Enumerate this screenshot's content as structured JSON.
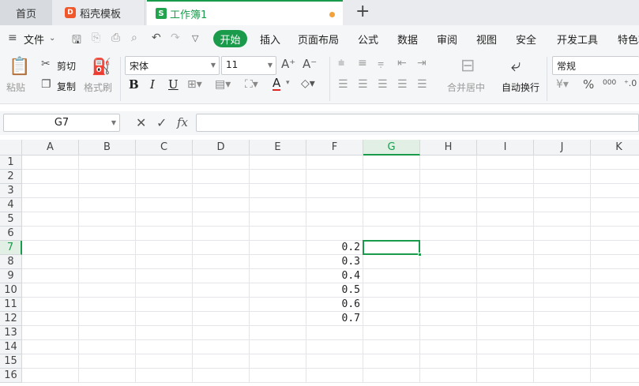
{
  "tabs": {
    "home": "首页",
    "template": "稻壳模板",
    "workbook": "工作簿1",
    "workbook_icon": "S",
    "template_icon": "D"
  },
  "menu": {
    "file": "文件",
    "start": "开始",
    "items": [
      "插入",
      "页面布局",
      "公式",
      "数据",
      "审阅",
      "视图",
      "安全",
      "开发工具",
      "特色功"
    ]
  },
  "ribbon": {
    "paste": "粘贴",
    "cut": "剪切",
    "copy": "复制",
    "format_painter": "格式刷",
    "font_name": "宋体",
    "font_size": "11",
    "merge_center": "合并居中",
    "wrap_text": "自动换行",
    "number_format": "常规",
    "percent_glyph": "%",
    "thousands_glyph": "000"
  },
  "formula_bar": {
    "name_box": "G7",
    "fx_label": "fx",
    "formula_value": ""
  },
  "sheet": {
    "columns": [
      "A",
      "B",
      "C",
      "D",
      "E",
      "F",
      "G",
      "H",
      "I",
      "J",
      "K"
    ],
    "rows": [
      "1",
      "2",
      "3",
      "4",
      "5",
      "6",
      "7",
      "8",
      "9",
      "10",
      "11",
      "12",
      "13",
      "14",
      "15",
      "16"
    ],
    "selected_column": "G",
    "selected_row": "7",
    "cells": [
      {
        "ref": "F7",
        "value": "0.2"
      },
      {
        "ref": "F8",
        "value": "0.3"
      },
      {
        "ref": "F9",
        "value": "0.4"
      },
      {
        "ref": "F10",
        "value": "0.5"
      },
      {
        "ref": "F11",
        "value": "0.6"
      },
      {
        "ref": "F12",
        "value": "0.7"
      }
    ]
  },
  "colors": {
    "accent": "#1a9b4b",
    "modified_dot": "#f3a13b"
  }
}
